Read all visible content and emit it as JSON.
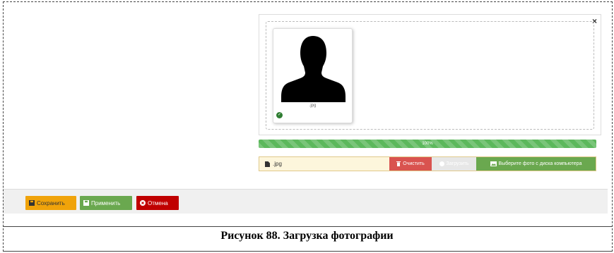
{
  "file_input": {
    "close_label": "×",
    "file_name": ".jpg",
    "progress_percent": 100,
    "progress_label": "100%",
    "caption_value": ".jpg",
    "clear_label": "Очистить",
    "upload_label": "Загрузить",
    "browse_label": "Выберите фото с диска компьютера"
  },
  "toolbar": {
    "save_label": "Сохранить",
    "apply_label": "Применить",
    "cancel_label": "Отмена"
  },
  "figure_caption": "Рисунок 88. Загрузка фотографии",
  "colors": {
    "progress": "#5cb85c",
    "clear": "#d9534f",
    "browse": "#6aa84f",
    "save": "#f0a30a",
    "apply": "#6aa84f",
    "cancel": "#c00000"
  }
}
